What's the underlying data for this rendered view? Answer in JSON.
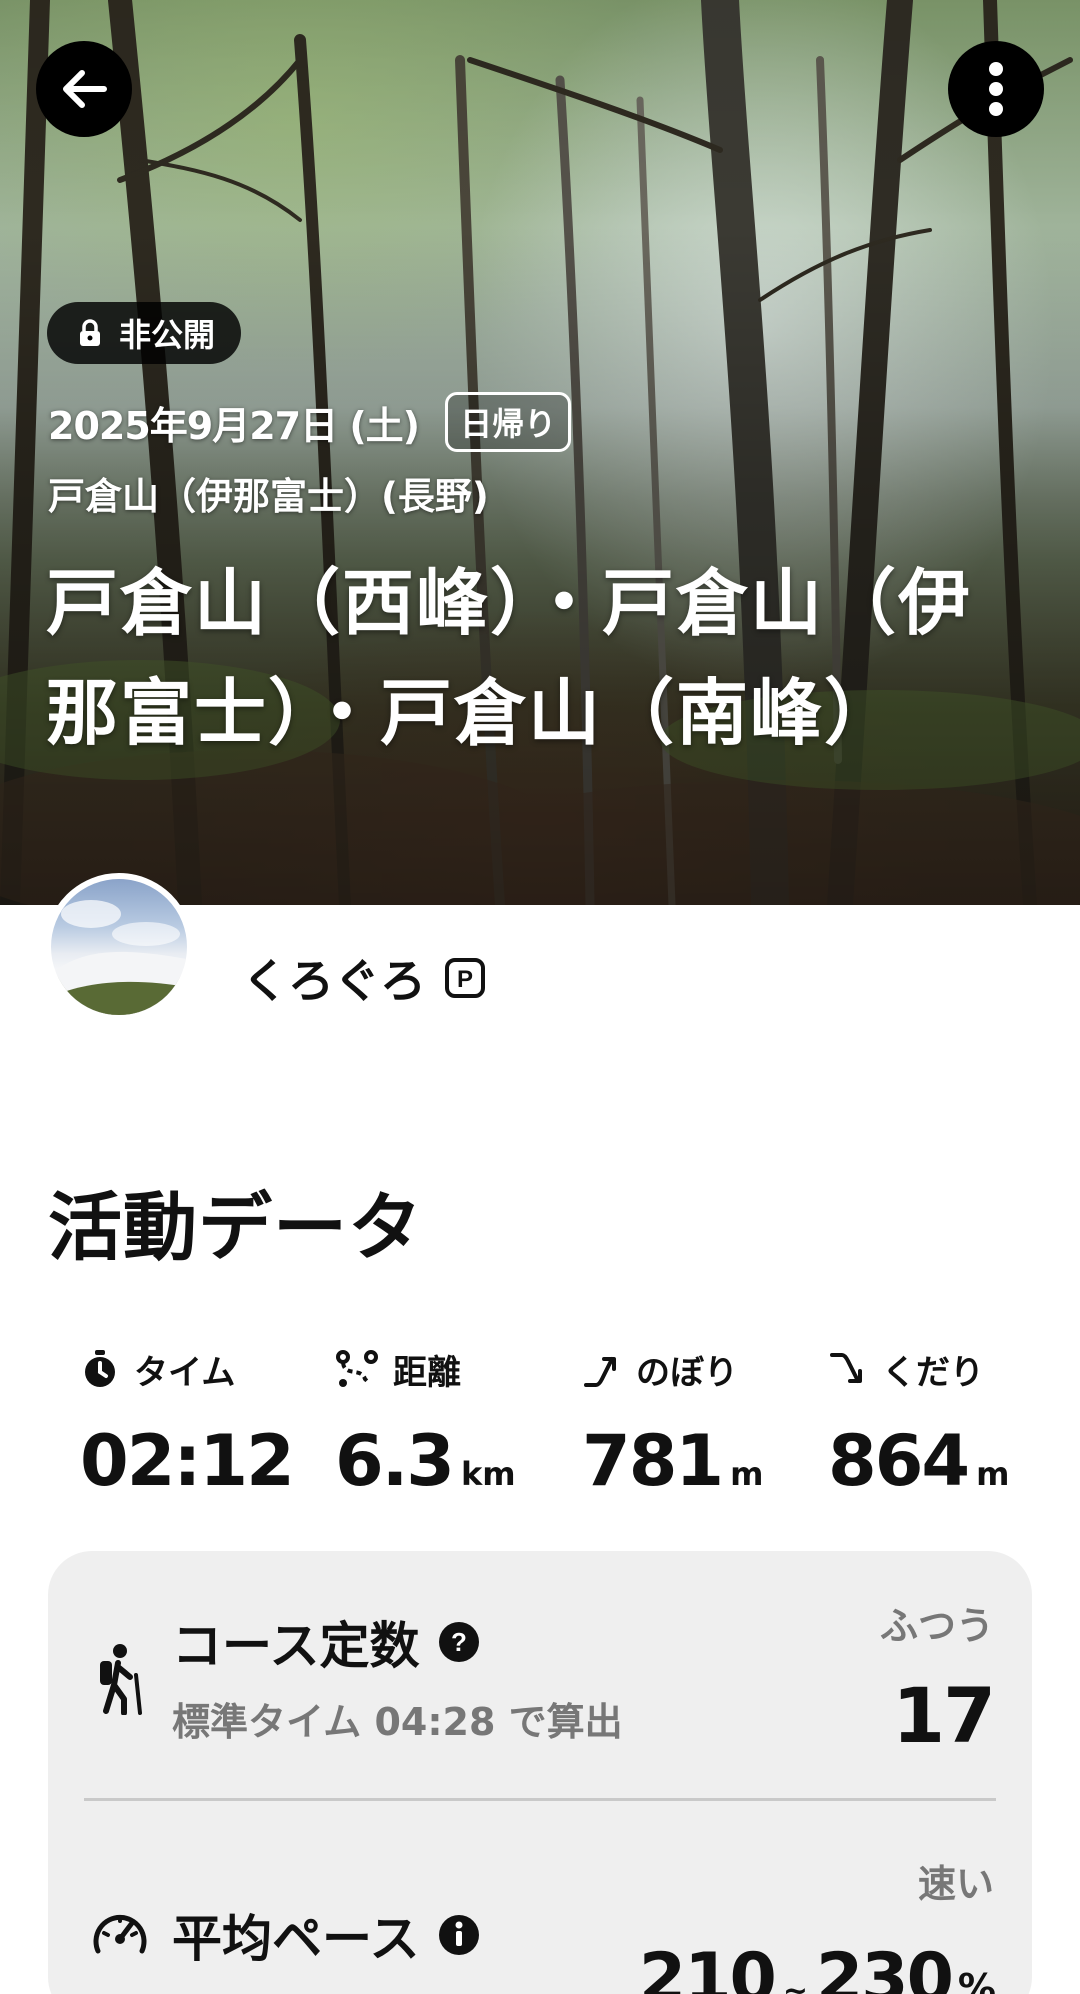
{
  "hero": {
    "privacy_label": "非公開",
    "date": "2025年9月27日 (土)",
    "trip_type": "日帰り",
    "area": "戸倉山（伊那富士）(長野)",
    "route_title": "戸倉山（西峰）・戸倉山（伊那富士）・戸倉山（南峰）"
  },
  "user": {
    "name": "くろぐろ",
    "badge": "P"
  },
  "activity": {
    "section_title": "活動データ",
    "stats": [
      {
        "icon": "stopwatch-icon",
        "label": "タイム",
        "value": "02:12",
        "unit": ""
      },
      {
        "icon": "route-distance-icon",
        "label": "距離",
        "value": "6.3",
        "unit": "km"
      },
      {
        "icon": "ascent-icon",
        "label": "のぼり",
        "value": "781",
        "unit": "m"
      },
      {
        "icon": "descent-icon",
        "label": "くだり",
        "value": "864",
        "unit": "m"
      }
    ],
    "course_constant": {
      "icon": "hiker-icon",
      "title": "コース定数",
      "subtitle": "標準タイム 04:28 で算出",
      "level": "ふつう",
      "value": "17"
    },
    "average_pace": {
      "icon": "speedometer-icon",
      "title": "平均ペース",
      "level": "速い",
      "low": "210",
      "separator": "~",
      "high": "230",
      "unit": "%"
    }
  }
}
